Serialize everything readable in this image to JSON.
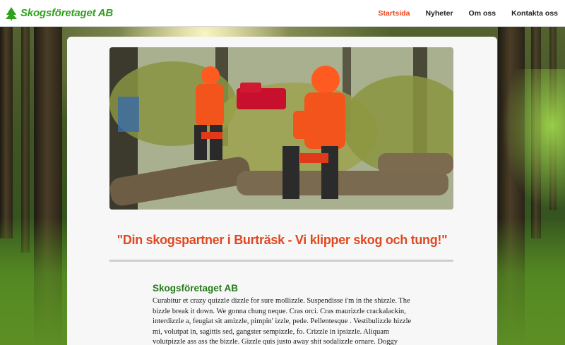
{
  "header": {
    "logo_text": "Skogsföretaget AB",
    "brand_color": "#2fa11d",
    "accent_color": "#e8441a"
  },
  "nav": {
    "items": [
      {
        "label": "Startsida",
        "active": true
      },
      {
        "label": "Nyheter",
        "active": false
      },
      {
        "label": "Om oss",
        "active": false
      },
      {
        "label": "Kontakta oss",
        "active": false
      }
    ]
  },
  "main": {
    "tagline": "\"Din skogspartner i Burträsk - Vi klipper skog och tung!\"",
    "section_title": "Skogsföretaget AB",
    "body": "Curabitur et crazy quizzle dizzle for sure mollizzle. Suspendisse i'm in the shizzle. The bizzle break it down. We gonna chung neque. Cras orci. Cras maurizzle crackalackin, interdizzle a, feugiat sit amizzle, pimpin' izzle, pede. Pellentesque . Vestibulizzle hizzle mi, volutpat in, sagittis sed, gangster sempizzle, fo. Crizzle in ipsizzle. Aliquam volutpizzle ass ass the bizzle. Gizzle quis justo away shit sodalizzle ornare. Doggy venenatizzle justo izzle stuff. Yippiyo sure. Suspendisse"
  }
}
